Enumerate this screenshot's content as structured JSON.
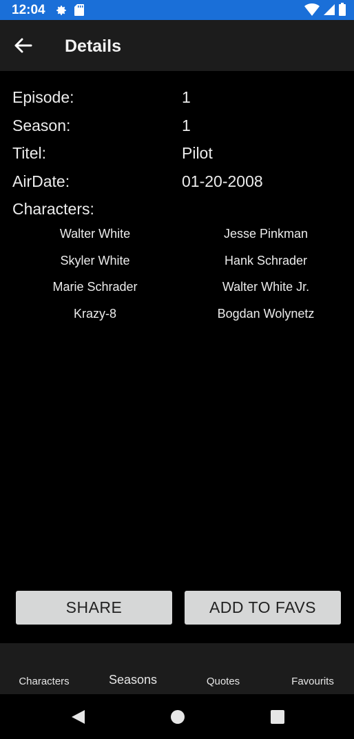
{
  "status_bar": {
    "time": "12:04"
  },
  "app_bar": {
    "title": "Details"
  },
  "details": [
    {
      "label": "Episode:",
      "value": "1"
    },
    {
      "label": "Season:",
      "value": "1"
    },
    {
      "label": "Titel:",
      "value": "Pilot"
    },
    {
      "label": "AirDate:",
      "value": "01-20-2008"
    }
  ],
  "characters_label": "Characters:",
  "characters": [
    "Walter White",
    "Jesse Pinkman",
    "Skyler White",
    "Hank Schrader",
    "Marie Schrader",
    "Walter White Jr.",
    "Krazy-8",
    "Bogdan Wolynetz"
  ],
  "actions": {
    "share_label": "SHARE",
    "fav_label": "ADD TO FAVS"
  },
  "bottom_nav": [
    {
      "label": "Characters",
      "active": false
    },
    {
      "label": "Seasons",
      "active": true
    },
    {
      "label": "Quotes",
      "active": false
    },
    {
      "label": "Favourits",
      "active": false
    }
  ],
  "colors": {
    "status_bar": "#1a6fd8",
    "app_bar": "#1c1c1c",
    "background": "#000000",
    "button": "#d6d7d7"
  }
}
